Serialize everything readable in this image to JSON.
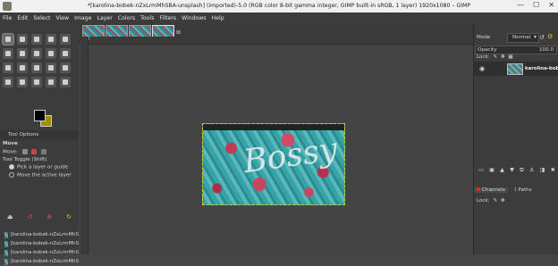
{
  "window": {
    "title": "*[karolina-bobek-nZxLrmMhSBA-unsplash] (imported)-5.0 (RGB color 8-bit gamma integer, GIMP built-in sRGB, 1 layer) 1920x1080 – GIMP",
    "minimize": "—",
    "maximize": "☐",
    "close": "✕"
  },
  "menu": [
    "File",
    "Edit",
    "Select",
    "View",
    "Image",
    "Layer",
    "Colors",
    "Tools",
    "Filters",
    "Windows",
    "Help"
  ],
  "tool_options": {
    "header": "Tool Options",
    "tool_name": "Move",
    "move_label": "Move:",
    "toggle_label": "Tool Toggle  (Shift)",
    "option1": "Pick a layer or guide",
    "option2": "Move the active layer"
  },
  "document_history": [
    "[karolina-bobek-nZxLrmMhS",
    "[karolina-bobek-nZxLrmMhS",
    "[karolina-bobek-nZxLrmMhS",
    "[karolina-bobek-nZxLrmMhS"
  ],
  "canvas": {
    "image_lettering": "Bossy"
  },
  "layers_panel": {
    "mode_label": "Mode",
    "mode_value": "Normal",
    "opacity_label": "Opacity",
    "opacity_value": "100.0",
    "lock_label": "Lock:",
    "layer_name": "karolina-bobek"
  },
  "bottom_dock": {
    "tab_channels": "Channels",
    "tab_paths": "Paths",
    "lock_label": "Lock:"
  },
  "colors": {
    "foreground": "#000000",
    "background": "#a09000"
  }
}
